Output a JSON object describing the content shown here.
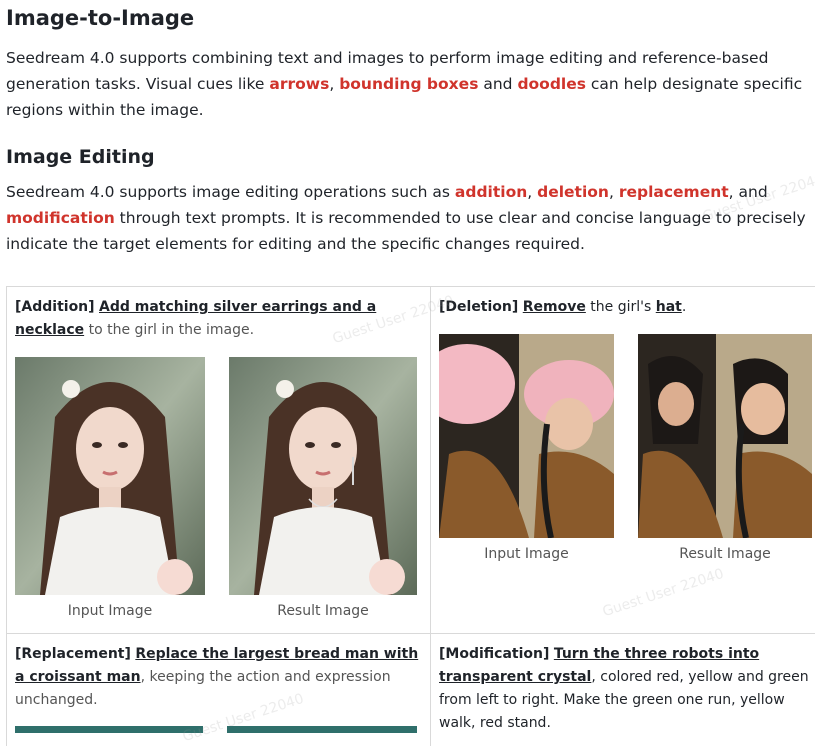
{
  "heading_main": "Image-to-Image",
  "intro": {
    "t1": "Seedream 4.0 supports combining text and images to perform image editing and reference-based generation tasks.  Visual cues like ",
    "arrows": "arrows",
    "t2": ", ",
    "bboxes": "bounding boxes",
    "t3": " and ",
    "doodles": "doodles",
    "t4": " can help designate specific regions within the image."
  },
  "heading_editing": "Image Editing",
  "editing": {
    "t1": "Seedream 4.0 supports image editing operations such as ",
    "addition": "addition",
    "c1": ", ",
    "deletion": "deletion",
    "c2": ", ",
    "replacement": "replacement",
    "c3": ", and ",
    "modification": "modification",
    "t2": " through text prompts. It is recommended to use clear and concise language to precisely indicate the target elements for editing and the specific changes required."
  },
  "cells": {
    "addition": {
      "tag": "[Addition]",
      "link": "Add matching silver earrings and a necklace",
      "rest": "to the girl in the image.",
      "input_caption": "Input Image",
      "result_caption": "Result Image"
    },
    "deletion": {
      "tag": "[Deletion]",
      "link1": "Remove",
      "mid": " the girl's ",
      "link2": "hat",
      "end": ".",
      "input_caption": "Input Image",
      "result_caption": "Result Image"
    },
    "replacement": {
      "tag": "[Replacement]",
      "link": "Replace the largest bread man with a croissant man",
      "rest": ", keeping the action and expression unchanged."
    },
    "modification": {
      "tag": "[Modification]",
      "link": "Turn the three robots into transparent crystal",
      "rest": ", colored red, yellow and green from left to right. Make the green one run, yellow walk, red stand."
    }
  },
  "watermark": "Guest User 22040",
  "colors": {
    "highlight": "#d0342c",
    "text": "#1f2329",
    "muted": "#555555"
  }
}
